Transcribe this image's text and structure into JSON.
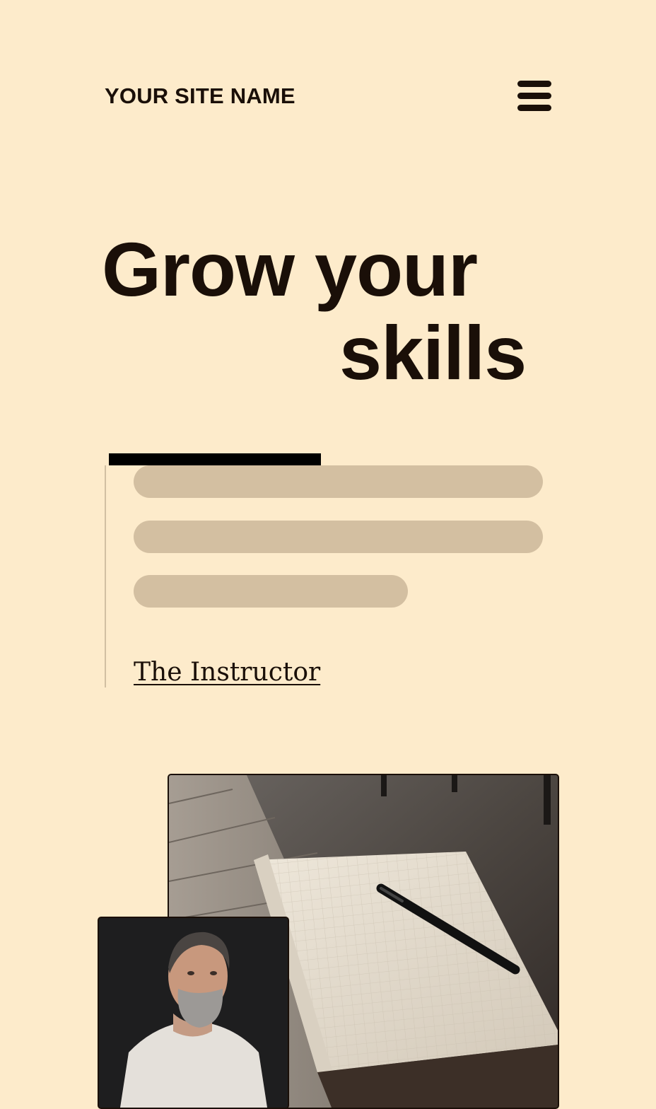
{
  "header": {
    "site_name": "YOUR SITE NAME",
    "menu_icon": "hamburger-menu-icon"
  },
  "hero": {
    "headline_line1": "Grow your",
    "headline_line2": "skills"
  },
  "quote": {
    "author_link": "The Instructor"
  },
  "images": {
    "notebook": "notebook-with-pen-photo",
    "portrait": "bearded-man-portrait-photo"
  },
  "colors": {
    "background": "#fdebcb",
    "text": "#1a0f08",
    "skeleton": "#d3bfa1",
    "rule": "#000000"
  }
}
